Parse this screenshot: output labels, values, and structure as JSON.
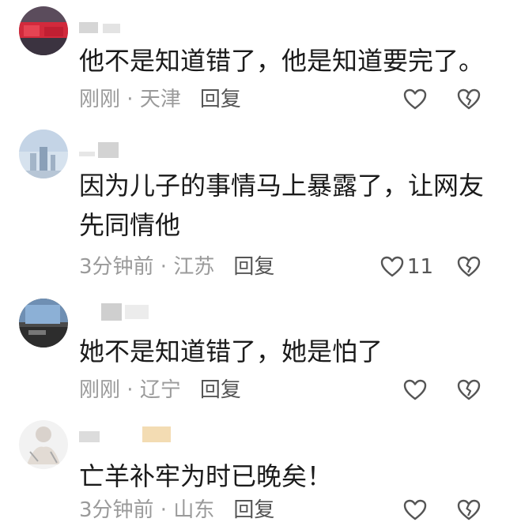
{
  "comments": [
    {
      "text": "他不是知道错了，他是知道要完了。",
      "time": "刚刚",
      "location": "天津",
      "reply": "回复",
      "likes": ""
    },
    {
      "text": "因为儿子的事情马上暴露了，让网友先同情他",
      "time": "3分钟前",
      "location": "江苏",
      "reply": "回复",
      "likes": "11"
    },
    {
      "text": "她不是知道错了，她是怕了",
      "time": "刚刚",
      "location": "辽宁",
      "reply": "回复",
      "likes": ""
    },
    {
      "text": "亡羊补牢为时已晚矣！",
      "time": "3分钟前",
      "location": "山东",
      "reply": "回复",
      "likes": ""
    }
  ],
  "separator": " · ",
  "icons": {
    "like": "heart-outline-icon",
    "dislike": "broken-heart-icon"
  },
  "colors": {
    "text": "#1a1a1a",
    "meta": "#9a9a9a",
    "reply": "#555555"
  }
}
